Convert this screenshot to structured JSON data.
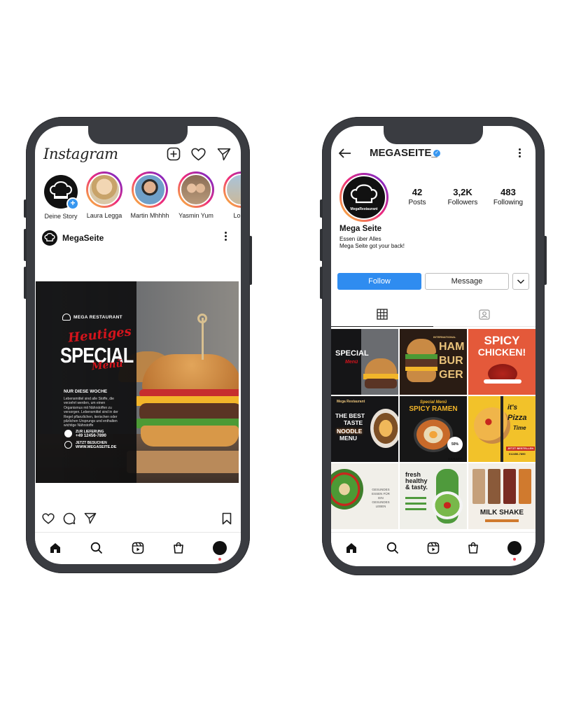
{
  "feed": {
    "logo": "Instagram",
    "stories": [
      {
        "name": "Deine Story",
        "own": true
      },
      {
        "name": "Laura Legga"
      },
      {
        "name": "Martin Mhhhh"
      },
      {
        "name": "Yasmin Yum"
      },
      {
        "name": "Loren"
      }
    ],
    "post": {
      "account": "MegaSeite",
      "brand": "MEGA RESTAURANT",
      "script_top": "Heutiges",
      "headline": "SPECIAL",
      "script_bottom": "Menü",
      "subheading": "NUR DIESE WOCHE",
      "body": "Lebensmittel sind alle Stoffe, die verzehrt werden, um einen Organismus mit Nährstoffen zu versorgen. Lebensmittel sind in der Regel pflanzlichen, tierischen oder pilzlichen Ursprungs und enthalten wichtige Nährstoffe",
      "delivery_label": "ZUR LIEFERUNG",
      "phone": "+49 12456-7890",
      "visit_label": "JETZT BESUCHEN",
      "website": "WWW.MEGASEITE.DE"
    }
  },
  "profile": {
    "username": "MEGASEITE_",
    "verified": true,
    "stats": [
      {
        "value": "42",
        "label": "Posts"
      },
      {
        "value": "3,2K",
        "label": "Followers"
      },
      {
        "value": "483",
        "label": "Following"
      }
    ],
    "name": "Mega Seite",
    "bio_line1": "Essen über Alles",
    "bio_line2": "Mega Seite got your back!",
    "follow_label": "Follow",
    "message_label": "Message",
    "avatar_brand": "MegaRestaurant",
    "grid": [
      {
        "line1": "SPECIAL",
        "line2": "Menü"
      },
      {
        "line1": "HAM",
        "line2": "BUR",
        "line3": "GER",
        "tag": "INTERNATIONAL"
      },
      {
        "line1": "SPICY",
        "line2": "CHICKEN!"
      },
      {
        "line1": "THE BEST",
        "line2": "TASTE",
        "line3": "NOODLE",
        "line4": "MENU",
        "brand": "Mega Restaurant"
      },
      {
        "line1": "Special Menü",
        "line2": "SPICY RAMEN",
        "badge": "50% RABATT"
      },
      {
        "line1": "it's",
        "line2": "Pizza",
        "line3": "Time",
        "cta": "JETZT BESTELLEN",
        "phone": "012456-7890"
      },
      {
        "line1": "GESUNDES",
        "line2": "ESSEN FÜR",
        "line3": "EIN",
        "line4": "GESUNDES",
        "line5": "LEBEN"
      },
      {
        "line1": "fresh",
        "line2": "healthy",
        "line3": "& tasty."
      },
      {
        "line1": "MILK SHAKE"
      }
    ]
  },
  "colors": {
    "frame": "#3a3c41",
    "follow_blue": "#2f8cf0",
    "verified_blue": "#3897f0",
    "notification_red": "#ed4956",
    "post_red": "#d4141c"
  }
}
